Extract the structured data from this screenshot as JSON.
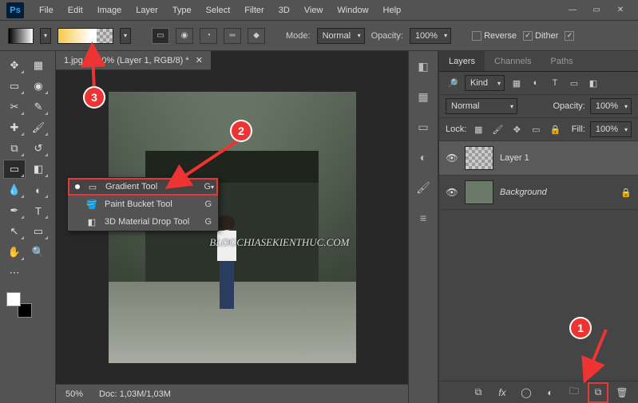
{
  "menubar": {
    "items": [
      "File",
      "Edit",
      "Image",
      "Layer",
      "Type",
      "Select",
      "Filter",
      "3D",
      "View",
      "Window",
      "Help"
    ]
  },
  "optbar": {
    "mode_label": "Mode:",
    "mode_value": "Normal",
    "opacity_label": "Opacity:",
    "opacity_value": "100%",
    "reverse": "Reverse",
    "dither": "Dither"
  },
  "doc_tab": "1.jpg @ 50% (Layer 1, RGB/8) *",
  "watermark": "BLOGCHIASEKIENTHUC.COM",
  "status": {
    "zoom": "50%",
    "doc": "Doc: 1,03M/1,03M"
  },
  "ctx": {
    "items": [
      {
        "label": "Gradient Tool",
        "sc": "G",
        "sel": true,
        "icon": "▭"
      },
      {
        "label": "Paint Bucket Tool",
        "sc": "G",
        "sel": false,
        "icon": "🪣"
      },
      {
        "label": "3D Material Drop Tool",
        "sc": "G",
        "sel": false,
        "icon": "◧"
      }
    ]
  },
  "panels": {
    "tabs": [
      "Layers",
      "Channels",
      "Paths"
    ],
    "filter": "Kind",
    "blend": "Normal",
    "opacity_label": "Opacity:",
    "opacity_value": "100%",
    "lock_label": "Lock:",
    "fill_label": "Fill:",
    "fill_value": "100%",
    "layers": [
      {
        "name": "Layer 1",
        "bg": false,
        "active": true
      },
      {
        "name": "Background",
        "bg": true,
        "active": false
      }
    ]
  },
  "callouts": {
    "c1": "1",
    "c2": "2",
    "c3": "3"
  }
}
